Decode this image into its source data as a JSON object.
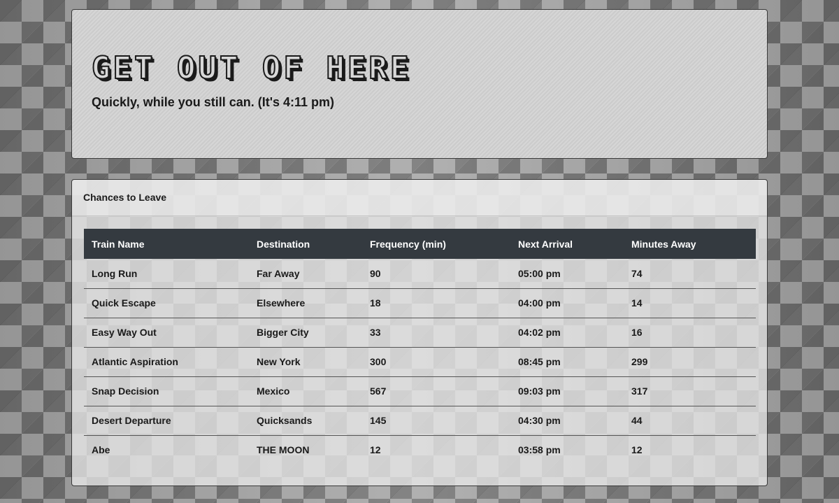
{
  "header": {
    "title": "GET OUT OF HERE",
    "subtitle": "Quickly, while you still can. (It's 4:11 pm)"
  },
  "panel": {
    "heading": "Chances to Leave",
    "table": {
      "columns": [
        "Train Name",
        "Destination",
        "Frequency (min)",
        "Next Arrival",
        "Minutes Away"
      ],
      "rows": [
        [
          "Long Run",
          "Far Away",
          "90",
          "05:00 pm",
          "74"
        ],
        [
          "Quick Escape",
          "Elsewhere",
          "18",
          "04:00 pm",
          "14"
        ],
        [
          "Easy Way Out",
          "Bigger City",
          "33",
          "04:02 pm",
          "16"
        ],
        [
          "Atlantic Aspiration",
          "New York",
          "300",
          "08:45 pm",
          "299"
        ],
        [
          "Snap Decision",
          "Mexico",
          "567",
          "09:03 pm",
          "317"
        ],
        [
          "Desert Departure",
          "Quicksands",
          "145",
          "04:30 pm",
          "44"
        ],
        [
          "Abe",
          "THE MOON",
          "12",
          "03:58 pm",
          "12"
        ]
      ]
    }
  }
}
